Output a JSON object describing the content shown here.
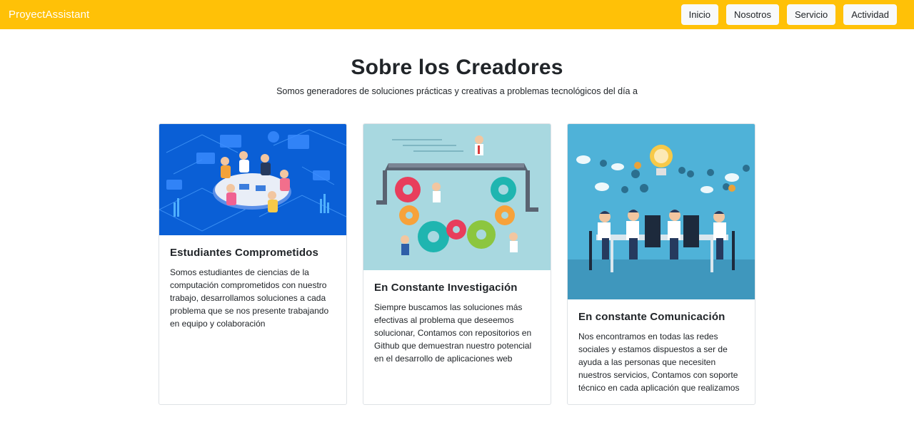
{
  "navbar": {
    "brand": "ProyectAssistant",
    "links": [
      "Inicio",
      "Nosotros",
      "Servicio",
      "Actividad"
    ],
    "color": "#ffc107"
  },
  "header": {
    "title": "Sobre los Creadores",
    "subtitle": "Somos generadores de soluciones prácticas y creativas a problemas tecnológicos del día a"
  },
  "cards": [
    {
      "image": "team-meeting-isometric-illustration",
      "title": "Estudiantes Comprometidos",
      "text": "Somos estudiantes de ciencias de la computación comprometidos con nuestro trabajo, desarrollamos soluciones a cada problema que se nos presente trabajando en equipo y colaboración"
    },
    {
      "image": "gears-teamwork-illustration",
      "title": "En Constante Investigación",
      "text": "Siempre buscamos las soluciones más efectivas al problema que deseemos solucionar, Contamos con repositorios en Github que demuestran nuestro potencial en el desarrollo de aplicaciones web"
    },
    {
      "image": "business-meeting-ideas-illustration",
      "title": "En constante Comunicación",
      "text": "Nos encontramos en todas las redes sociales y estamos dispuestos a ser de ayuda a las personas que necesiten nuestros servicios, Contamos con soporte técnico en cada aplicación que realizamos"
    }
  ]
}
